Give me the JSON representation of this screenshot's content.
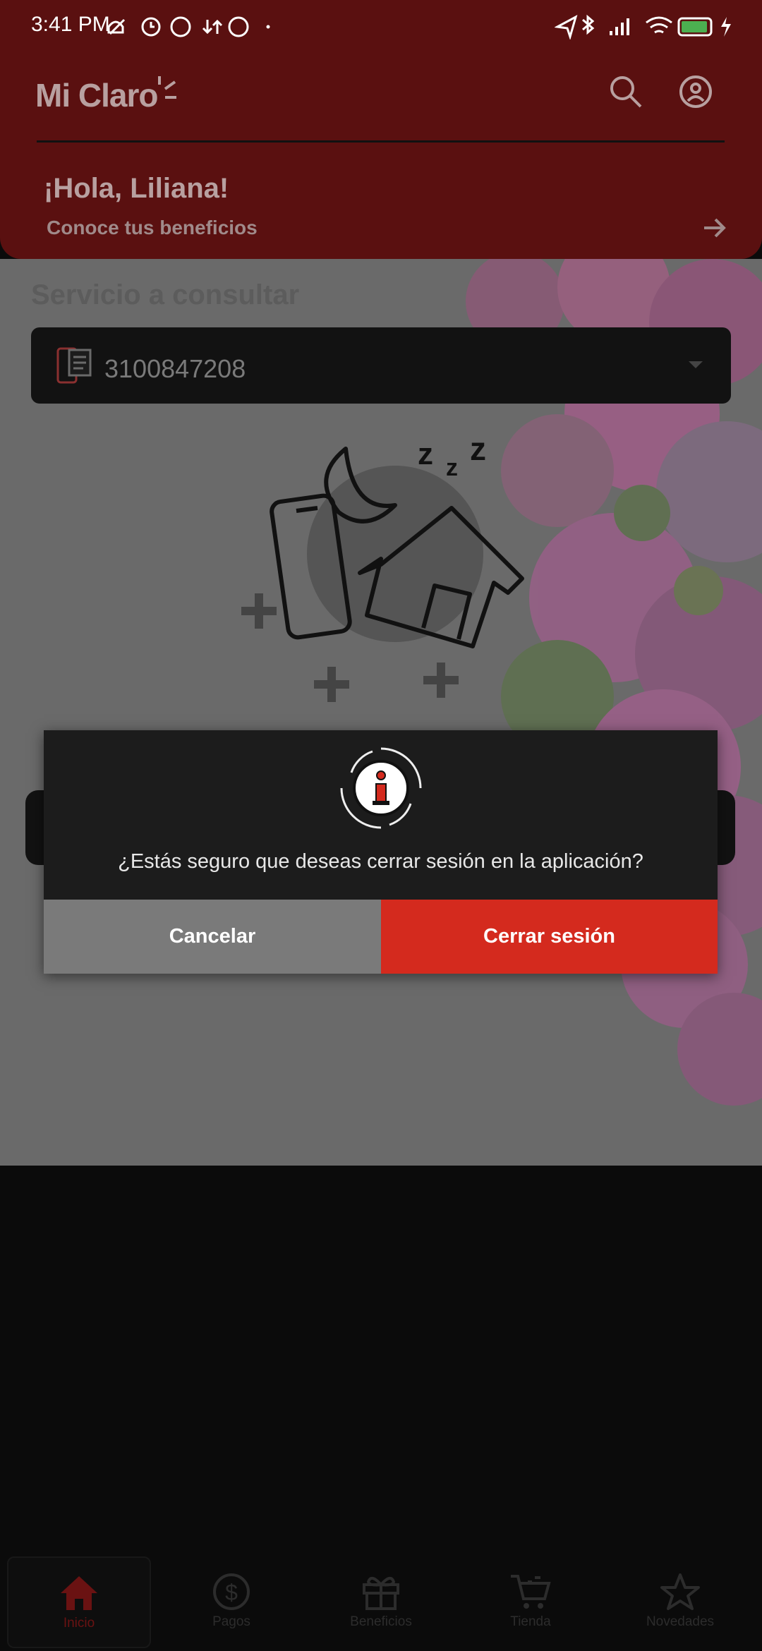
{
  "status_bar": {
    "time": "3:41 PM",
    "battery": "80"
  },
  "header": {
    "logo": "Mi Claro",
    "greeting": "¡Hola, Liliana!",
    "benefits_link": "Conoce tus beneficios"
  },
  "content": {
    "section_title": "Servicio a consultar",
    "service_number": "3100847208"
  },
  "dialog": {
    "message": "¿Estás seguro que deseas cerrar sesión en la aplicación?",
    "cancel_label": "Cancelar",
    "logout_label": "Cerrar sesión"
  },
  "bottom_nav": {
    "items": [
      {
        "label": "Inicio",
        "icon": "home-icon",
        "active": true
      },
      {
        "label": "Pagos",
        "icon": "dollar-icon"
      },
      {
        "label": "Beneficios",
        "icon": "gift-icon"
      },
      {
        "label": "Tienda",
        "icon": "cart-icon"
      },
      {
        "label": "Novedades",
        "icon": "star-icon"
      }
    ]
  },
  "colors": {
    "brand_red": "#d42a1e",
    "header_dimmed": "#5a1010",
    "overlay_gray": "#6a6a6a"
  }
}
